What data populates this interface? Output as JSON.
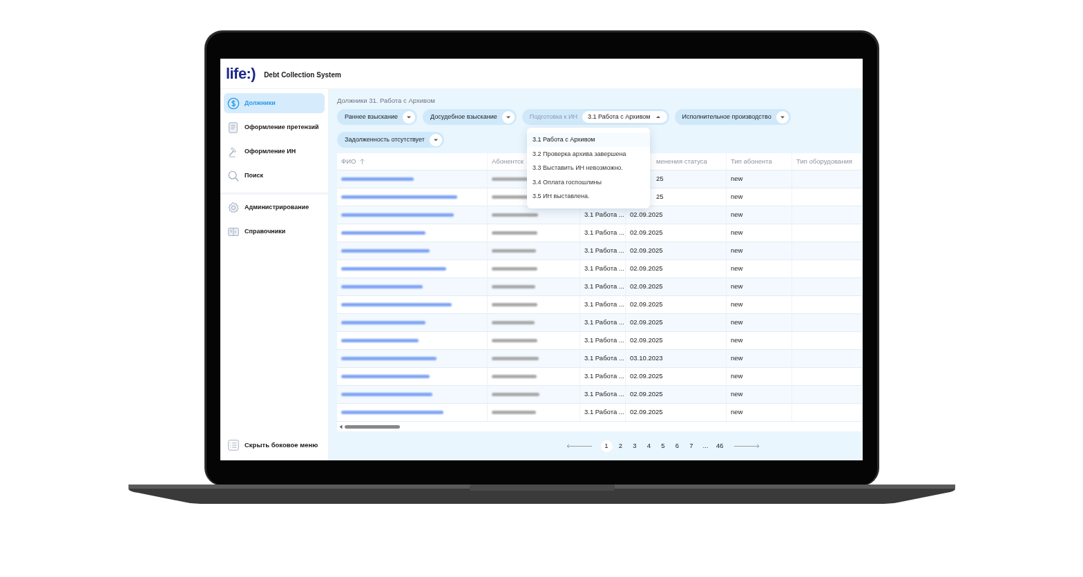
{
  "header": {
    "logo": "life:)",
    "title": "Debt Collection System"
  },
  "sidebar": {
    "items": [
      {
        "label": "Должники",
        "kind": "dollar",
        "selected": true
      },
      {
        "label": "Оформление претензий",
        "kind": "document",
        "selected": false
      },
      {
        "label": "Оформление ИН",
        "kind": "gavel",
        "selected": false
      },
      {
        "label": "Поиск",
        "kind": "search",
        "selected": false
      },
      {
        "label": "Администрирование",
        "kind": "gear",
        "selected": false,
        "divider_before": true
      },
      {
        "label": "Справочники",
        "kind": "book",
        "selected": false
      }
    ],
    "hide_button": "Скрыть боковое меню"
  },
  "breadcrumb": "Должники 31. Работа с Архивом",
  "filters": [
    {
      "label": "Раннее взыскание",
      "kind": "plain",
      "expanded": false
    },
    {
      "label": "Досудебное взыскание",
      "kind": "plain",
      "expanded": false
    },
    {
      "label": "Подготовка к ИН",
      "kind": "valued",
      "value": "3.1 Работа с Архивом",
      "expanded": true,
      "options": [
        {
          "label": "3.1 Работа с Архивом",
          "selected": true
        },
        {
          "label": "3.2 Проверка архива завершена",
          "selected": false
        },
        {
          "label": "3.3 Выставить ИН невозможно.",
          "selected": false
        },
        {
          "label": "3.4 Оплата госпошлины",
          "selected": false
        },
        {
          "label": "3.5 ИН выставлена.",
          "selected": false
        }
      ]
    },
    {
      "label": "Исполнительное производство",
      "kind": "plain",
      "expanded": false
    },
    {
      "label": "Задолженность отсутствует",
      "kind": "plain",
      "expanded": false
    }
  ],
  "table": {
    "columns": [
      {
        "label": "ФИО",
        "sorted": true
      },
      {
        "label": "Абонентск"
      },
      {},
      {
        "label": "менения статуса"
      },
      {
        "label": "Тип абонента"
      },
      {
        "label": "Тип оборудования"
      }
    ],
    "rows": [
      {
        "date": "25",
        "type": "new"
      },
      {
        "date": "25",
        "type": "new"
      },
      {
        "status": "3.1 Работа ...",
        "date": "02.09.2025",
        "type": "new"
      },
      {
        "status": "3.1 Работа ...",
        "date": "02.09.2025",
        "type": "new"
      },
      {
        "status": "3.1 Работа ...",
        "date": "02.09.2025",
        "type": "new"
      },
      {
        "status": "3.1 Работа ...",
        "date": "02.09.2025",
        "type": "new"
      },
      {
        "status": "3.1 Работа ...",
        "date": "02.09.2025",
        "type": "new"
      },
      {
        "status": "3.1 Работа ...",
        "date": "02.09.2025",
        "type": "new"
      },
      {
        "status": "3.1 Работа ...",
        "date": "02.09.2025",
        "type": "new"
      },
      {
        "status": "3.1 Работа ...",
        "date": "02.09.2025",
        "type": "new"
      },
      {
        "status": "3.1 Работа ...",
        "date": "03.10.2023",
        "type": "new"
      },
      {
        "status": "3.1 Работа ...",
        "date": "02.09.2025",
        "type": "new"
      },
      {
        "status": "3.1 Работа ...",
        "date": "02.09.2025",
        "type": "new"
      },
      {
        "status": "3.1 Работа ...",
        "date": "02.09.2025",
        "type": "new"
      }
    ]
  },
  "pagination": [
    {
      "label": "1",
      "selected": true
    },
    {
      "label": "2",
      "selected": false
    },
    {
      "label": "3",
      "selected": false
    },
    {
      "label": "4",
      "selected": false
    },
    {
      "label": "5",
      "selected": false
    },
    {
      "label": "6",
      "selected": false
    },
    {
      "label": "7",
      "selected": false
    },
    {
      "label": "...",
      "selected": false
    },
    {
      "label": "46",
      "selected": false
    }
  ]
}
